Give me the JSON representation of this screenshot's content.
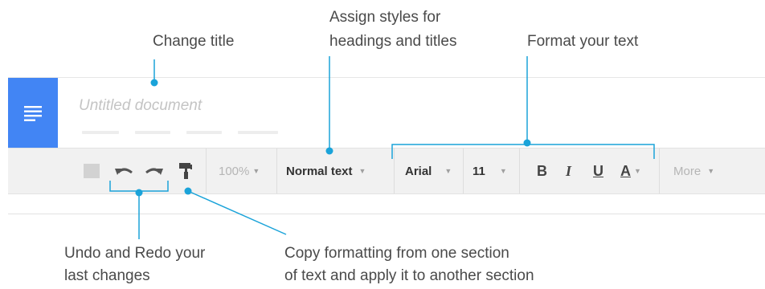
{
  "callouts": {
    "change_title": "Change title",
    "assign_styles_line1": "Assign styles for",
    "assign_styles_line2": "headings and titles",
    "format_text": "Format your text",
    "undo_redo_line1": "Undo and Redo your",
    "undo_redo_line2": "last changes",
    "copy_format_line1": "Copy formatting from one section",
    "copy_format_line2": "of text and apply it to another section"
  },
  "document": {
    "title_placeholder": "Untitled document"
  },
  "toolbar": {
    "zoom": "100%",
    "style": "Normal text",
    "font": "Arial",
    "size": "11",
    "bold": "B",
    "italic": "I",
    "underline": "U",
    "text_color": "A",
    "more": "More"
  },
  "colors": {
    "accent_blue": "#4285f4",
    "leader_blue": "#1aa3d9",
    "toolbar_bg": "#f1f1f1"
  },
  "icons": [
    "docs-logo-icon",
    "undo-icon",
    "redo-icon",
    "paint-format-icon",
    "print-icon"
  ]
}
